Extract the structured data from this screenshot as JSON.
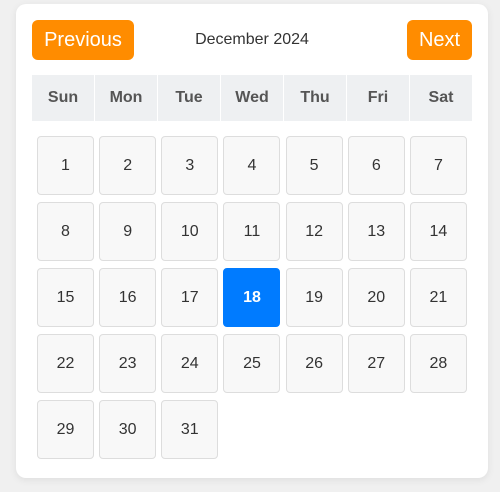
{
  "calendar": {
    "prev_label": "Previous",
    "next_label": "Next",
    "month_label": "December 2024",
    "weekdays": [
      "Sun",
      "Mon",
      "Tue",
      "Wed",
      "Thu",
      "Fri",
      "Sat"
    ],
    "selected_day": "18",
    "days": [
      "1",
      "2",
      "3",
      "4",
      "5",
      "6",
      "7",
      "8",
      "9",
      "10",
      "11",
      "12",
      "13",
      "14",
      "15",
      "16",
      "17",
      "18",
      "19",
      "20",
      "21",
      "22",
      "23",
      "24",
      "25",
      "26",
      "27",
      "28",
      "29",
      "30",
      "31"
    ]
  },
  "colors": {
    "nav_button": "#ff8c00",
    "selected_day": "#007bff",
    "weekday_header_bg": "#eef0f2",
    "day_cell_bg": "#f8f8f8"
  }
}
